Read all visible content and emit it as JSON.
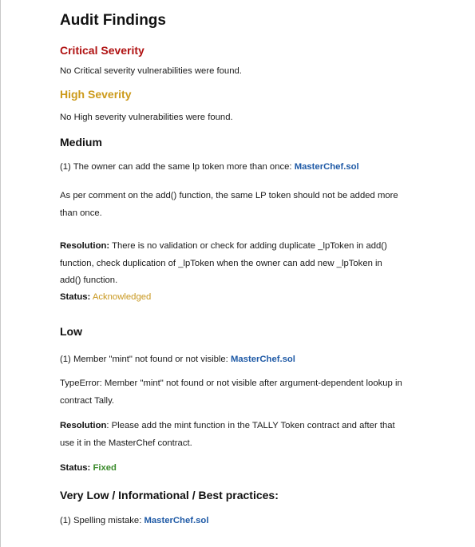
{
  "title": "Audit Findings",
  "critical": {
    "heading": "Critical Severity",
    "text": "No Critical severity vulnerabilities were found."
  },
  "high": {
    "heading": "High Severity",
    "text": "No High severity vulnerabilities were found."
  },
  "medium": {
    "heading": "Medium",
    "issue_text": "(1) The owner can add the same lp token more than once: ",
    "issue_file": "MasterChef.sol",
    "description": [
      "As per comment on the add() function, the same LP token should not be added more",
      "than once."
    ],
    "resolution_label": "Resolution:",
    "resolution_lines": [
      " There is no validation or check for adding duplicate _lpToken in add()",
      "function, check duplication of _lpToken when the owner can add new _lpToken in",
      "add() function."
    ],
    "status_label": "Status:",
    "status_value": "Acknowledged"
  },
  "low": {
    "heading": "Low",
    "issue_text": "(1) Member \"mint\" not found or not visible: ",
    "issue_file": "MasterChef.sol",
    "description": [
      "TypeError: Member \"mint\" not found or not visible after argument-dependent lookup in",
      "contract Tally."
    ],
    "resolution_label": "Resolution",
    "resolution_lines": [
      ": Please add the mint function in the TALLY Token contract and after that",
      "use it in the MasterChef contract."
    ],
    "status_label": "Status:",
    "status_value": "Fixed"
  },
  "very_low": {
    "heading": "Very Low / Informational / Best practices:",
    "issue_text": "(1) Spelling mistake: ",
    "issue_file": "MasterChef.sol"
  },
  "colors": {
    "critical": "#b01212",
    "high": "#cc9a1a",
    "link": "#1f5aa6",
    "acknowledged": "#c8971e",
    "fixed": "#3a8a2a"
  }
}
